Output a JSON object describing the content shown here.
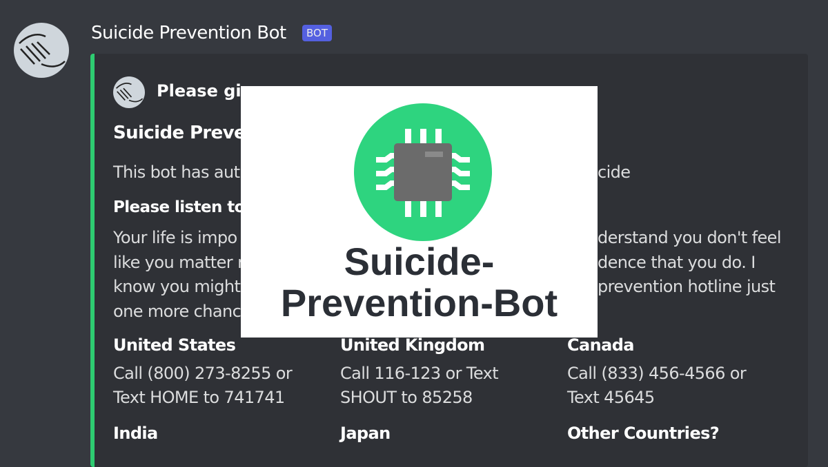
{
  "message": {
    "author": "Suicide Prevention Bot",
    "badge": "BOT"
  },
  "embed": {
    "author_fragment": "Please give",
    "title_fragment": "Suicide Preven",
    "desc_left": "This bot has aut",
    "desc_right": "cide",
    "listen_fragment": "Please listen to",
    "para_left": [
      "Your life is impo",
      "like you matter r",
      "know you might",
      "one more chanc"
    ],
    "para_right": [
      "derstand you don't feel",
      "dence that you do. I",
      "prevention hotline just",
      ""
    ],
    "hotlines": [
      {
        "country": "United States",
        "lines": [
          "Call (800) 273-8255 or",
          "Text HOME to 741741"
        ]
      },
      {
        "country": "United Kingdom",
        "lines": [
          "Call 116-123 or Text",
          "SHOUT to 85258"
        ]
      },
      {
        "country": "Canada",
        "lines": [
          "Call (833) 456-4566 or",
          "Text 45645"
        ]
      },
      {
        "country": "India",
        "lines": []
      },
      {
        "country": "Japan",
        "lines": []
      },
      {
        "country": "Other Countries?",
        "lines": []
      }
    ]
  },
  "overlay": {
    "logo_line1": "Suicide-",
    "logo_line2": "Prevention-Bot",
    "brand_color": "#2ed47f",
    "chip_color": "#6b6b6b"
  }
}
